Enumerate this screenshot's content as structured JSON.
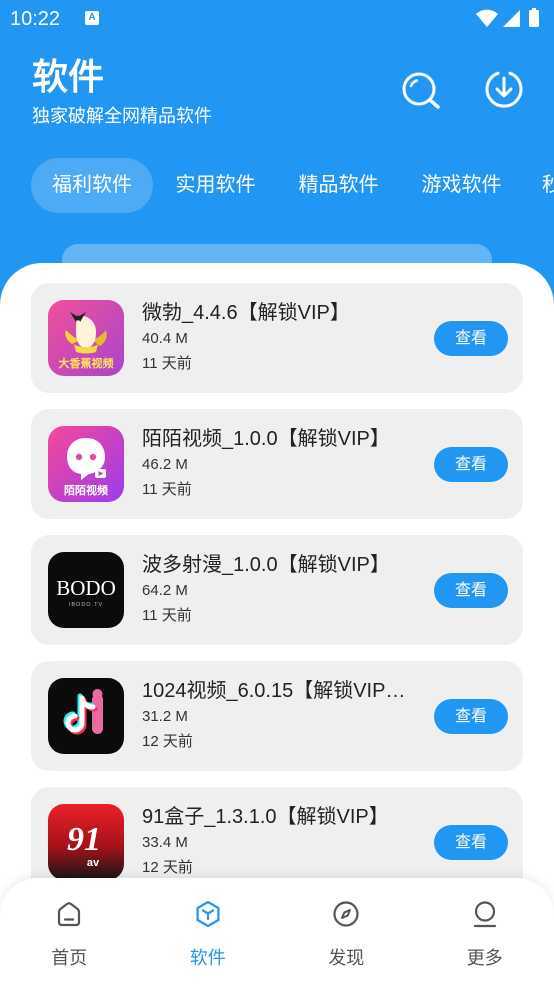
{
  "status_bar": {
    "time": "10:22",
    "notification_letter": "A",
    "icons": [
      "notification-icon",
      "wifi-icon",
      "signal-icon",
      "battery-icon"
    ]
  },
  "header": {
    "title": "软件",
    "subtitle": "独家破解全网精品软件",
    "actions": [
      "search-icon",
      "download-icon"
    ]
  },
  "tabs": [
    {
      "label": "福利软件",
      "selected": true
    },
    {
      "label": "实用软件",
      "selected": false
    },
    {
      "label": "精品软件",
      "selected": false
    },
    {
      "label": "游戏软件",
      "selected": false
    },
    {
      "label": "秒",
      "selected": false
    }
  ],
  "apps": [
    {
      "title": "微勃_4.4.6【解锁VIP】",
      "size": "40.4 M",
      "date": "11 天前",
      "button": "查看",
      "logo": {
        "icon": "banana-logo",
        "text": "大香蕉视频"
      }
    },
    {
      "title": "陌陌视频_1.0.0【解锁VIP】",
      "size": "46.2 M",
      "date": "11 天前",
      "button": "查看",
      "logo": {
        "icon": "ghost-logo",
        "text": "陌陌视频"
      }
    },
    {
      "title": "波多射漫_1.0.0【解锁VIP】",
      "size": "64.2 M",
      "date": "11 天前",
      "button": "查看",
      "logo": {
        "icon": "bodo-logo",
        "text": "BODO",
        "subtext": "IBODO.TV"
      }
    },
    {
      "title": "1024视频_6.0.15【解锁VIP…",
      "size": "31.2 M",
      "date": "12 天前",
      "button": "查看",
      "logo": {
        "icon": "music-note-logo"
      }
    },
    {
      "title": "91盒子_1.3.1.0【解锁VIP】",
      "size": "33.4 M",
      "date": "12 天前",
      "button": "查看",
      "logo": {
        "icon": "91av-logo",
        "text": "91",
        "subtext": "av"
      }
    }
  ],
  "bottom_nav": [
    {
      "label": "首页",
      "icon": "home-icon",
      "selected": false
    },
    {
      "label": "软件",
      "icon": "cube-icon",
      "selected": true
    },
    {
      "label": "发现",
      "icon": "compass-icon",
      "selected": false
    },
    {
      "label": "更多",
      "icon": "person-icon",
      "selected": false
    }
  ],
  "colors": {
    "primary": "#2196F3",
    "card_background": "#EFEFEF",
    "tab_highlight": "#4DABF5"
  }
}
